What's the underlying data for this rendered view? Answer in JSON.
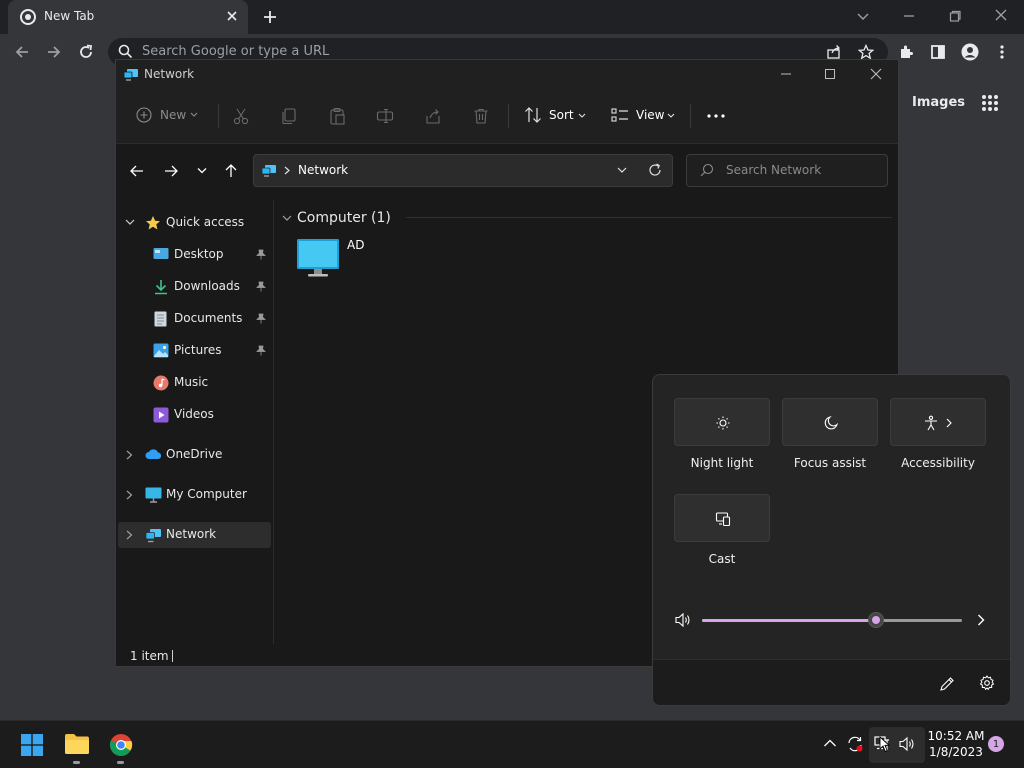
{
  "browser": {
    "tab_title": "New Tab",
    "omnibox_placeholder": "Search Google or type a URL",
    "images_link": "Images"
  },
  "explorer": {
    "title": "Network",
    "commands": {
      "new_label": "New",
      "sort_label": "Sort",
      "view_label": "View"
    },
    "address_location": "Network",
    "search_placeholder": "Search Network",
    "nav": {
      "quick_access": "Quick access",
      "pinned": [
        {
          "label": "Desktop"
        },
        {
          "label": "Downloads"
        },
        {
          "label": "Documents"
        },
        {
          "label": "Pictures"
        }
      ],
      "music": "Music",
      "videos": "Videos",
      "onedrive": "OneDrive",
      "my_computer": "My Computer",
      "network": "Network"
    },
    "group_header": "Computer (1)",
    "items": [
      {
        "name": "AD"
      }
    ],
    "status_text": "1 item"
  },
  "quick_settings": {
    "tiles": [
      {
        "label": "Night light",
        "icon": "brightness-icon"
      },
      {
        "label": "Focus assist",
        "icon": "moon-icon"
      },
      {
        "label": "Accessibility",
        "icon": "accessibility-icon"
      },
      {
        "label": "Cast",
        "icon": "cast-icon"
      }
    ],
    "volume_level": 0.67,
    "accent_color": "#d6a5e6"
  },
  "taskbar": {
    "time": "10:52 AM",
    "date": "1/8/2023",
    "notification_count": "1"
  }
}
